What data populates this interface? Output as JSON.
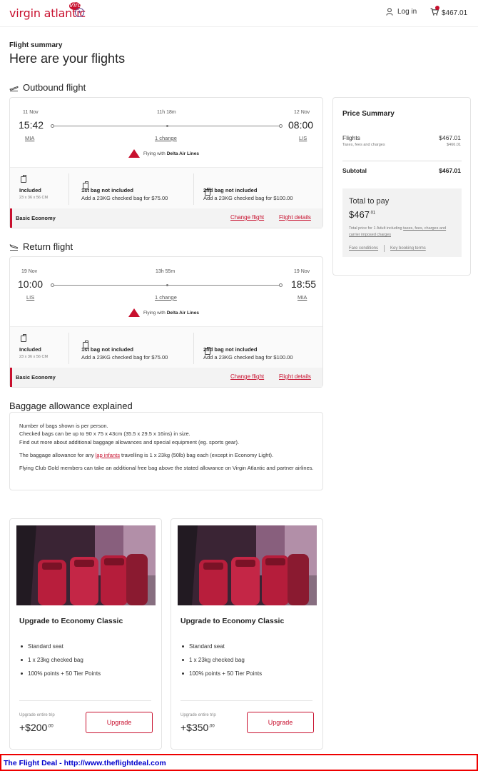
{
  "header": {
    "brand": "virgin atlantic",
    "brand_mark": "Virgin",
    "login_label": "Log in",
    "cart_total": "$467.01"
  },
  "summary": {
    "kicker": "Flight summary",
    "title": "Here are your flights"
  },
  "outbound": {
    "heading": "Outbound flight",
    "dep_date": "11 Nov",
    "arr_date": "12 Nov",
    "duration": "11h 18m",
    "dep_time": "15:42",
    "arr_time": "08:00",
    "dep_code": "MIA",
    "arr_code": "LIS",
    "stops": "1 change",
    "flying_with_prefix": "Flying with",
    "carrier": "Delta Air Lines",
    "bag1_title": "Included",
    "bag1_sub": "23 x 36 x 56 CM",
    "bag2_title": "1st bag not included",
    "bag2_text": "Add a 23KG checked bag for $75.00",
    "bag3_title": "2nd bag not included",
    "bag3_text": "Add a 23KG checked bag for $100.00",
    "fare": "Basic Economy",
    "change_link": "Change flight",
    "details_link": "Flight details"
  },
  "return": {
    "heading": "Return flight",
    "dep_date": "19 Nov",
    "arr_date": "19 Nov",
    "duration": "13h 55m",
    "dep_time": "10:00",
    "arr_time": "18:55",
    "dep_code": "LIS",
    "arr_code": "MIA",
    "stops": "1 change",
    "flying_with_prefix": "Flying with",
    "carrier": "Delta Air Lines",
    "bag1_title": "Included",
    "bag1_sub": "23 x 36 x 56 CM",
    "bag2_title": "1st bag not included",
    "bag2_text": "Add a 23KG checked bag for $75.00",
    "bag3_title": "2nd bag not included",
    "bag3_text": "Add a 23KG checked bag for $100.00",
    "fare": "Basic Economy",
    "change_link": "Change flight",
    "details_link": "Flight details"
  },
  "price_summary": {
    "title": "Price Summary",
    "flights_label": "Flights",
    "flights_value": "$467.01",
    "taxes_label": "Taxes, fees and charges",
    "taxes_value": "$466.01",
    "subtotal_label": "Subtotal",
    "subtotal_value": "$467.01",
    "total_label": "Total to pay",
    "total_main": "$467",
    "total_cents": ".01",
    "note_prefix": "Total price for 1 Adult including",
    "note_link": "taxes, fees, charges and carrier imposed charges",
    "fare_conditions": "Fare conditions",
    "key_terms": "Key booking terms"
  },
  "baggage": {
    "heading": "Baggage allowance explained",
    "line1": "Number of bags shown is per person.",
    "line2": "Checked bags can be up to 90 x 75 x 43cm (35.5 x 29.5 x 16ins) in size.",
    "line3": "Find out more about additional baggage allowances and special equipment (eg. sports gear).",
    "line4_prefix": "The baggage allowance for any",
    "line4_link": "lap infants",
    "line4_suffix": "travelling is 1 x 23kg (50lb) bag each (except in Economy Light).",
    "line5": "Flying Club Gold members can take an additional free bag above the stated allowance on Virgin Atlantic and partner airlines."
  },
  "upgrades": [
    {
      "title": "Upgrade to Economy Classic",
      "features": [
        "Standard seat",
        "1 x 23kg checked bag",
        "100% points + 50 Tier Points"
      ],
      "label": "Upgrade entire trip",
      "price_main": "+$200",
      "price_cents": ".00",
      "button": "Upgrade"
    },
    {
      "title": "Upgrade to Economy Classic",
      "features": [
        "Standard seat",
        "1 x 23kg checked bag",
        "100% points + 50 Tier Points"
      ],
      "label": "Upgrade entire trip",
      "price_main": "+$350",
      "price_cents": ".00",
      "button": "Upgrade"
    }
  ],
  "footer": {
    "text": "The Flight Deal - http://www.theflightdeal.com"
  },
  "colors": {
    "brand_red": "#c8102e",
    "footer_link": "#0000cc",
    "footer_border": "#ee0000"
  }
}
